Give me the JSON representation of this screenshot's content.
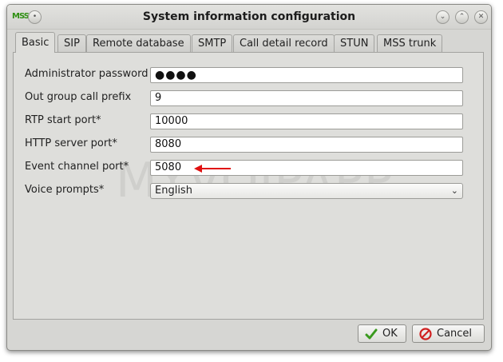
{
  "window": {
    "title": "System information configuration",
    "app_icon": "MSS",
    "title_buttons": [
      "minimize",
      "maximize",
      "close"
    ]
  },
  "tabs": [
    {
      "label": "Basic",
      "active": true
    },
    {
      "label": "SIP",
      "active": false
    },
    {
      "label": "Remote database",
      "active": false
    },
    {
      "label": "SMTP",
      "active": false
    },
    {
      "label": "Call detail record",
      "active": false
    },
    {
      "label": "STUN",
      "active": false
    },
    {
      "label": "MSS trunk",
      "active": false
    }
  ],
  "form": {
    "admin_password": {
      "label": "Administrator password",
      "value": "●●●●"
    },
    "out_group_prefix": {
      "label": "Out group call prefix",
      "value": "9"
    },
    "rtp_start_port": {
      "label": "RTP start port*",
      "value": "10000"
    },
    "http_server_port": {
      "label": "HTTP server port*",
      "value": "8080"
    },
    "event_channel_port": {
      "label": "Event channel port*",
      "value": "5080"
    },
    "voice_prompts": {
      "label": "Voice prompts*",
      "value": "English"
    }
  },
  "watermark": "MYVOIPAPP",
  "buttons": {
    "ok": "OK",
    "cancel": "Cancel"
  },
  "colors": {
    "ok_check": "#3a9a1e",
    "cancel_icon": "#d02020",
    "annotation_arrow": "#e01010"
  }
}
